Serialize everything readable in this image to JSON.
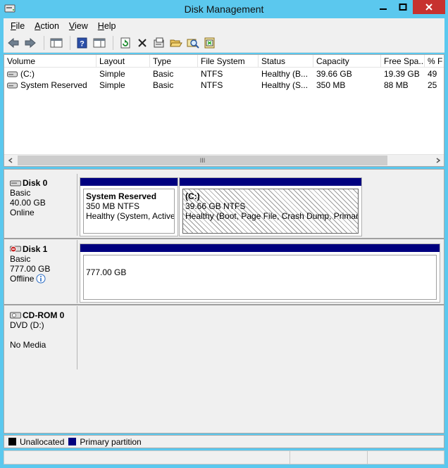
{
  "window": {
    "title": "Disk Management"
  },
  "menu": [
    {
      "label": "File",
      "key": "F",
      "rest": "ile"
    },
    {
      "label": "Action",
      "key": "A",
      "rest": "ction"
    },
    {
      "label": "View",
      "key": "V",
      "rest": "iew"
    },
    {
      "label": "Help",
      "key": "H",
      "rest": "elp"
    }
  ],
  "toolbar": {
    "buttons": [
      "back-icon",
      "forward-icon",
      "show-hide-console-tree-icon",
      "help-icon",
      "properties-pane-icon",
      "refresh-icon",
      "delete-icon",
      "properties-icon",
      "open-icon",
      "explore-icon",
      "disk-settings-icon"
    ]
  },
  "volume_list": {
    "columns": [
      "Volume",
      "Layout",
      "Type",
      "File System",
      "Status",
      "Capacity",
      "Free Spa...",
      "% F"
    ],
    "rows": [
      {
        "volume": "(C:)",
        "layout": "Simple",
        "type": "Basic",
        "fs": "NTFS",
        "status": "Healthy (B...",
        "capacity": "39.66 GB",
        "free": "19.39 GB",
        "pct": "49"
      },
      {
        "volume": "System Reserved",
        "layout": "Simple",
        "type": "Basic",
        "fs": "NTFS",
        "status": "Healthy (S...",
        "capacity": "350 MB",
        "free": "88 MB",
        "pct": "25"
      }
    ],
    "scroll_grip": "III"
  },
  "disks": [
    {
      "name": "Disk 0",
      "type": "Basic",
      "size": "40.00 GB",
      "state": "Online",
      "partitions": [
        {
          "title": "System Reserved",
          "size_fs": "350 MB NTFS",
          "status": "Healthy (System, Active,",
          "hatched": false
        },
        {
          "title": "(C:)",
          "size_fs": "39.66 GB NTFS",
          "status": "Healthy (Boot, Page File, Crash Dump, Primary",
          "hatched": true
        }
      ]
    },
    {
      "name": "Disk 1",
      "type": "Basic",
      "size": "777.00 GB",
      "state": "Offline",
      "partitions": [
        {
          "title": "",
          "size_fs": "777.00 GB",
          "status": "",
          "hatched": false
        }
      ]
    },
    {
      "name": "CD-ROM 0",
      "type": "DVD (D:)",
      "size": "",
      "state": "No Media",
      "partitions": []
    }
  ],
  "legend": [
    {
      "label": "Unallocated",
      "color": "#000000"
    },
    {
      "label": "Primary partition",
      "color": "#00007f"
    }
  ],
  "colors": {
    "titlebar": "#5bc8ee",
    "primary_partition": "#00007f",
    "close_button": "#c7322f"
  }
}
